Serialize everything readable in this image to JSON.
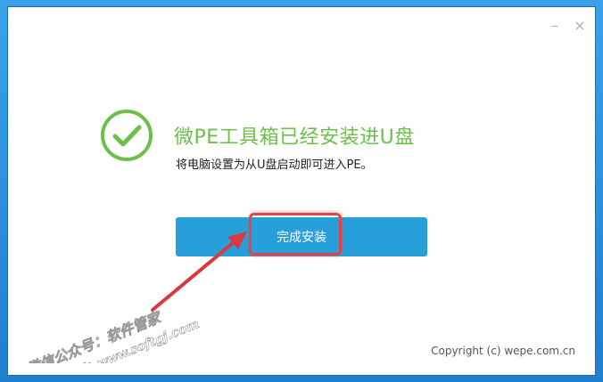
{
  "window": {
    "minimize_glyph": "–",
    "close_glyph": "×"
  },
  "status": {
    "title": "微PE工具箱已经安装进U盘",
    "subtitle": "将电脑设置为从U盘启动即可进入PE。",
    "icon": "check-circle-icon",
    "success_color": "#6cc04a"
  },
  "actions": {
    "finish_label": "完成安装",
    "button_color": "#27a0d9"
  },
  "annotation": {
    "highlight_color": "#e0454b"
  },
  "watermark": {
    "line1": "微信公众号：软件管家",
    "line2": "官网：www.softgj.com"
  },
  "footer": {
    "copyright": "Copyright (c) wepe.com.cn"
  }
}
